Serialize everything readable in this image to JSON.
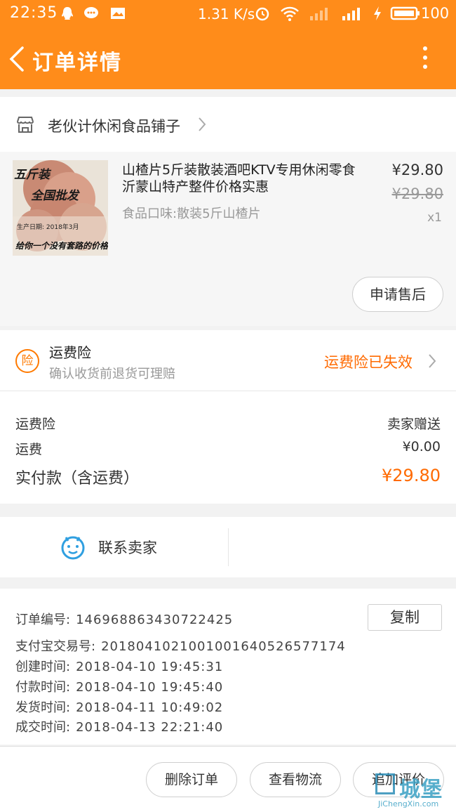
{
  "statusbar": {
    "time": "22:35",
    "speed": "1.31 K/s",
    "battery": "100"
  },
  "nav": {
    "title": "订单详情"
  },
  "shop": {
    "name": "老伙计休闲食品铺子"
  },
  "item": {
    "title": "山楂片5斤装散装酒吧KTV专用休闲零食沂蒙山特产整件价格实惠",
    "spec": "食品口味:散装5斤山楂片",
    "price": "¥29.80",
    "original_price": "¥29.80",
    "quantity": "x1",
    "image_text": {
      "line1": "五斤装",
      "line2": "全国批发",
      "line3": "生产日期: 2018年3月",
      "line4": "给你一个没有套路的价格"
    },
    "after_sale_label": "申请售后"
  },
  "insurance": {
    "badge": "险",
    "title": "运费险",
    "subtitle": "确认收货前退货可理赔",
    "status": "运费险已失效"
  },
  "fees": [
    {
      "label": "运费险",
      "value": "卖家赠送"
    },
    {
      "label": "运费",
      "value": "¥0.00"
    },
    {
      "label": "实付款（含运费）",
      "value": "¥29.80"
    }
  ],
  "contact": {
    "label": "联系卖家"
  },
  "order_info": {
    "copy_label": "复制",
    "lines": [
      {
        "key": "订单编号:",
        "value": "146968863430722425"
      },
      {
        "key": "支付宝交易号:",
        "value": "2018041021001001640526577174"
      },
      {
        "key": "创建时间:",
        "value": "2018-04-10 19:45:31"
      },
      {
        "key": "付款时间:",
        "value": "2018-04-10 19:45:40"
      },
      {
        "key": "发货时间:",
        "value": "2018-04-11 10:49:02"
      },
      {
        "key": "成交时间:",
        "value": "2018-04-13 22:21:40"
      }
    ]
  },
  "actions": {
    "delete": "删除订单",
    "logistics": "查看物流",
    "review": "追加评价"
  },
  "watermark": {
    "main": "城堡",
    "sub": "JiChengXin.com"
  },
  "colors": {
    "primary": "#ff8c1a",
    "accent": "#ff6a00"
  },
  "icons": [
    "back-icon",
    "more-icon",
    "shop-icon",
    "chevron-right-icon",
    "insurance-badge-icon",
    "chat-smile-icon"
  ]
}
